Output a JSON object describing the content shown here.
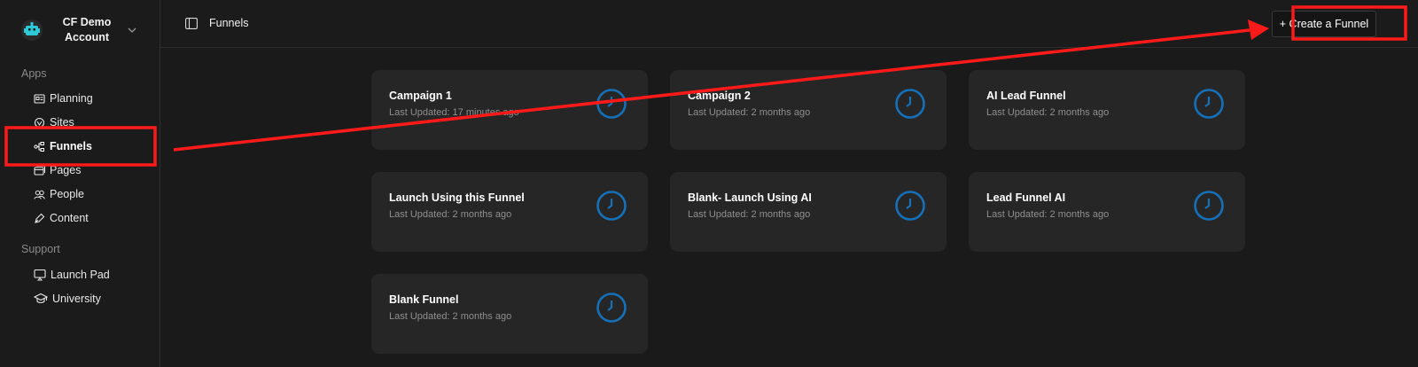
{
  "account": {
    "name": "CF Demo Account"
  },
  "sidebar": {
    "apps_label": "Apps",
    "apps": [
      {
        "label": "Planning",
        "icon": "planning-icon"
      },
      {
        "label": "Sites",
        "icon": "sites-icon"
      },
      {
        "label": "Funnels",
        "icon": "funnels-icon",
        "active": true
      },
      {
        "label": "Pages",
        "icon": "pages-icon"
      },
      {
        "label": "People",
        "icon": "people-icon"
      },
      {
        "label": "Content",
        "icon": "content-icon"
      }
    ],
    "support_label": "Support",
    "support": [
      {
        "label": "Launch Pad",
        "icon": "launch-pad-icon"
      },
      {
        "label": "University",
        "icon": "university-icon"
      }
    ]
  },
  "header": {
    "title": "Funnels",
    "create_label": "+ Create a Funnel"
  },
  "funnels": [
    {
      "title": "Campaign 1",
      "updated": "Last Updated: 17 minutes ago"
    },
    {
      "title": "Campaign 2",
      "updated": "Last Updated: 2 months ago"
    },
    {
      "title": "AI Lead Funnel",
      "updated": "Last Updated: 2 months ago"
    },
    {
      "title": "Launch Using this Funnel",
      "updated": "Last Updated: 2 months ago"
    },
    {
      "title": "Blank- Launch Using AI",
      "updated": "Last Updated: 2 months ago"
    },
    {
      "title": "Lead Funnel AI",
      "updated": "Last Updated: 2 months ago"
    },
    {
      "title": "Blank Funnel",
      "updated": "Last Updated: 2 months ago"
    }
  ],
  "colors": {
    "background": "#1a1a1a",
    "card": "#262626",
    "clock_accent": "#1670b8",
    "annotation": "#ff1a1a"
  }
}
